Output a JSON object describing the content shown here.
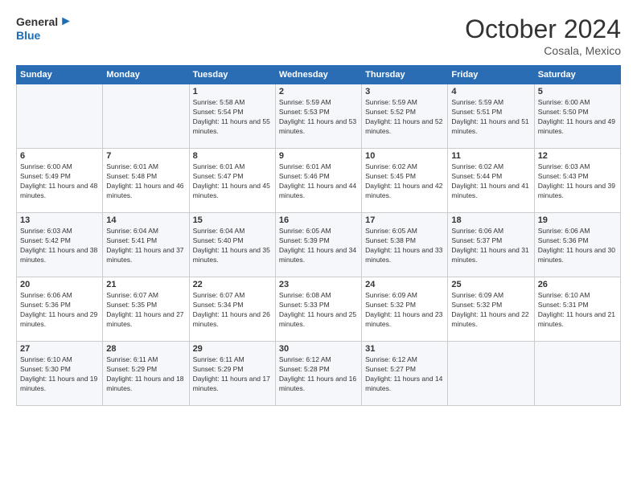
{
  "header": {
    "logo_general": "General",
    "logo_blue": "Blue",
    "month_title": "October 2024",
    "location": "Cosala, Mexico"
  },
  "weekdays": [
    "Sunday",
    "Monday",
    "Tuesday",
    "Wednesday",
    "Thursday",
    "Friday",
    "Saturday"
  ],
  "weeks": [
    [
      {
        "day": "",
        "info": ""
      },
      {
        "day": "",
        "info": ""
      },
      {
        "day": "1",
        "info": "Sunrise: 5:58 AM\nSunset: 5:54 PM\nDaylight: 11 hours and 55 minutes."
      },
      {
        "day": "2",
        "info": "Sunrise: 5:59 AM\nSunset: 5:53 PM\nDaylight: 11 hours and 53 minutes."
      },
      {
        "day": "3",
        "info": "Sunrise: 5:59 AM\nSunset: 5:52 PM\nDaylight: 11 hours and 52 minutes."
      },
      {
        "day": "4",
        "info": "Sunrise: 5:59 AM\nSunset: 5:51 PM\nDaylight: 11 hours and 51 minutes."
      },
      {
        "day": "5",
        "info": "Sunrise: 6:00 AM\nSunset: 5:50 PM\nDaylight: 11 hours and 49 minutes."
      }
    ],
    [
      {
        "day": "6",
        "info": "Sunrise: 6:00 AM\nSunset: 5:49 PM\nDaylight: 11 hours and 48 minutes."
      },
      {
        "day": "7",
        "info": "Sunrise: 6:01 AM\nSunset: 5:48 PM\nDaylight: 11 hours and 46 minutes."
      },
      {
        "day": "8",
        "info": "Sunrise: 6:01 AM\nSunset: 5:47 PM\nDaylight: 11 hours and 45 minutes."
      },
      {
        "day": "9",
        "info": "Sunrise: 6:01 AM\nSunset: 5:46 PM\nDaylight: 11 hours and 44 minutes."
      },
      {
        "day": "10",
        "info": "Sunrise: 6:02 AM\nSunset: 5:45 PM\nDaylight: 11 hours and 42 minutes."
      },
      {
        "day": "11",
        "info": "Sunrise: 6:02 AM\nSunset: 5:44 PM\nDaylight: 11 hours and 41 minutes."
      },
      {
        "day": "12",
        "info": "Sunrise: 6:03 AM\nSunset: 5:43 PM\nDaylight: 11 hours and 39 minutes."
      }
    ],
    [
      {
        "day": "13",
        "info": "Sunrise: 6:03 AM\nSunset: 5:42 PM\nDaylight: 11 hours and 38 minutes."
      },
      {
        "day": "14",
        "info": "Sunrise: 6:04 AM\nSunset: 5:41 PM\nDaylight: 11 hours and 37 minutes."
      },
      {
        "day": "15",
        "info": "Sunrise: 6:04 AM\nSunset: 5:40 PM\nDaylight: 11 hours and 35 minutes."
      },
      {
        "day": "16",
        "info": "Sunrise: 6:05 AM\nSunset: 5:39 PM\nDaylight: 11 hours and 34 minutes."
      },
      {
        "day": "17",
        "info": "Sunrise: 6:05 AM\nSunset: 5:38 PM\nDaylight: 11 hours and 33 minutes."
      },
      {
        "day": "18",
        "info": "Sunrise: 6:06 AM\nSunset: 5:37 PM\nDaylight: 11 hours and 31 minutes."
      },
      {
        "day": "19",
        "info": "Sunrise: 6:06 AM\nSunset: 5:36 PM\nDaylight: 11 hours and 30 minutes."
      }
    ],
    [
      {
        "day": "20",
        "info": "Sunrise: 6:06 AM\nSunset: 5:36 PM\nDaylight: 11 hours and 29 minutes."
      },
      {
        "day": "21",
        "info": "Sunrise: 6:07 AM\nSunset: 5:35 PM\nDaylight: 11 hours and 27 minutes."
      },
      {
        "day": "22",
        "info": "Sunrise: 6:07 AM\nSunset: 5:34 PM\nDaylight: 11 hours and 26 minutes."
      },
      {
        "day": "23",
        "info": "Sunrise: 6:08 AM\nSunset: 5:33 PM\nDaylight: 11 hours and 25 minutes."
      },
      {
        "day": "24",
        "info": "Sunrise: 6:09 AM\nSunset: 5:32 PM\nDaylight: 11 hours and 23 minutes."
      },
      {
        "day": "25",
        "info": "Sunrise: 6:09 AM\nSunset: 5:32 PM\nDaylight: 11 hours and 22 minutes."
      },
      {
        "day": "26",
        "info": "Sunrise: 6:10 AM\nSunset: 5:31 PM\nDaylight: 11 hours and 21 minutes."
      }
    ],
    [
      {
        "day": "27",
        "info": "Sunrise: 6:10 AM\nSunset: 5:30 PM\nDaylight: 11 hours and 19 minutes."
      },
      {
        "day": "28",
        "info": "Sunrise: 6:11 AM\nSunset: 5:29 PM\nDaylight: 11 hours and 18 minutes."
      },
      {
        "day": "29",
        "info": "Sunrise: 6:11 AM\nSunset: 5:29 PM\nDaylight: 11 hours and 17 minutes."
      },
      {
        "day": "30",
        "info": "Sunrise: 6:12 AM\nSunset: 5:28 PM\nDaylight: 11 hours and 16 minutes."
      },
      {
        "day": "31",
        "info": "Sunrise: 6:12 AM\nSunset: 5:27 PM\nDaylight: 11 hours and 14 minutes."
      },
      {
        "day": "",
        "info": ""
      },
      {
        "day": "",
        "info": ""
      }
    ]
  ]
}
